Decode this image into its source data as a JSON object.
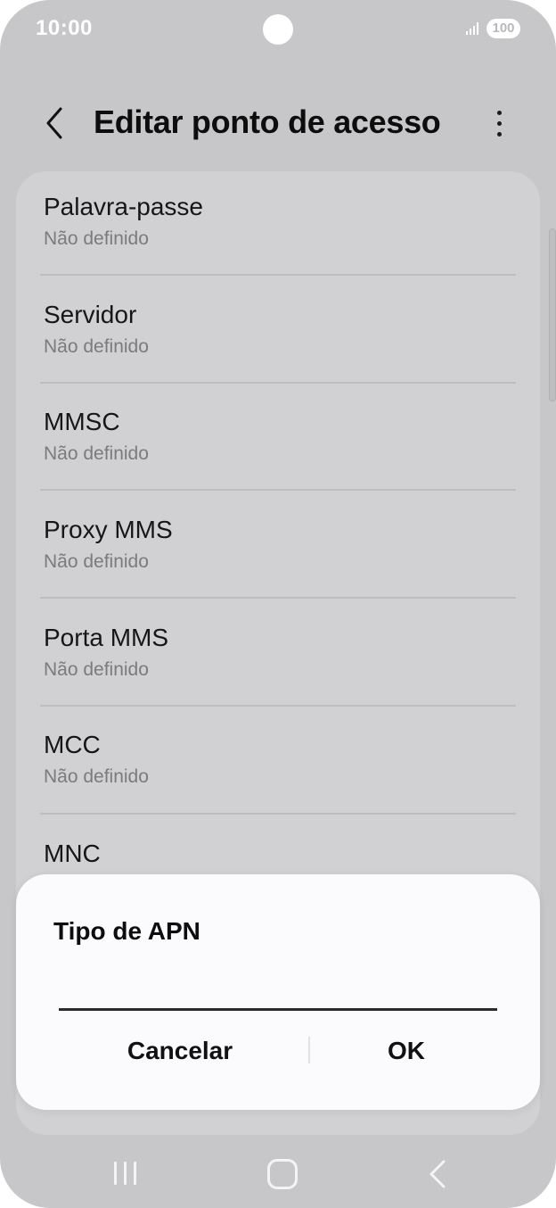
{
  "status_bar": {
    "time": "10:00",
    "battery": "100"
  },
  "app_bar": {
    "title": "Editar ponto de acesso"
  },
  "settings": [
    {
      "label": "Palavra-passe",
      "value": "Não definido"
    },
    {
      "label": "Servidor",
      "value": "Não definido"
    },
    {
      "label": "MMSC",
      "value": "Não definido"
    },
    {
      "label": "Proxy MMS",
      "value": "Não definido"
    },
    {
      "label": "Porta MMS",
      "value": "Não definido"
    },
    {
      "label": "MCC",
      "value": "Não definido"
    },
    {
      "label": "MNC",
      "value": ""
    }
  ],
  "dialog": {
    "title": "Tipo de APN",
    "input_value": "",
    "cancel_label": "Cancelar",
    "ok_label": "OK"
  },
  "colors": {
    "background": "#c7c7c9",
    "card": "#d1d1d3",
    "dialog": "#fbfbfd"
  }
}
